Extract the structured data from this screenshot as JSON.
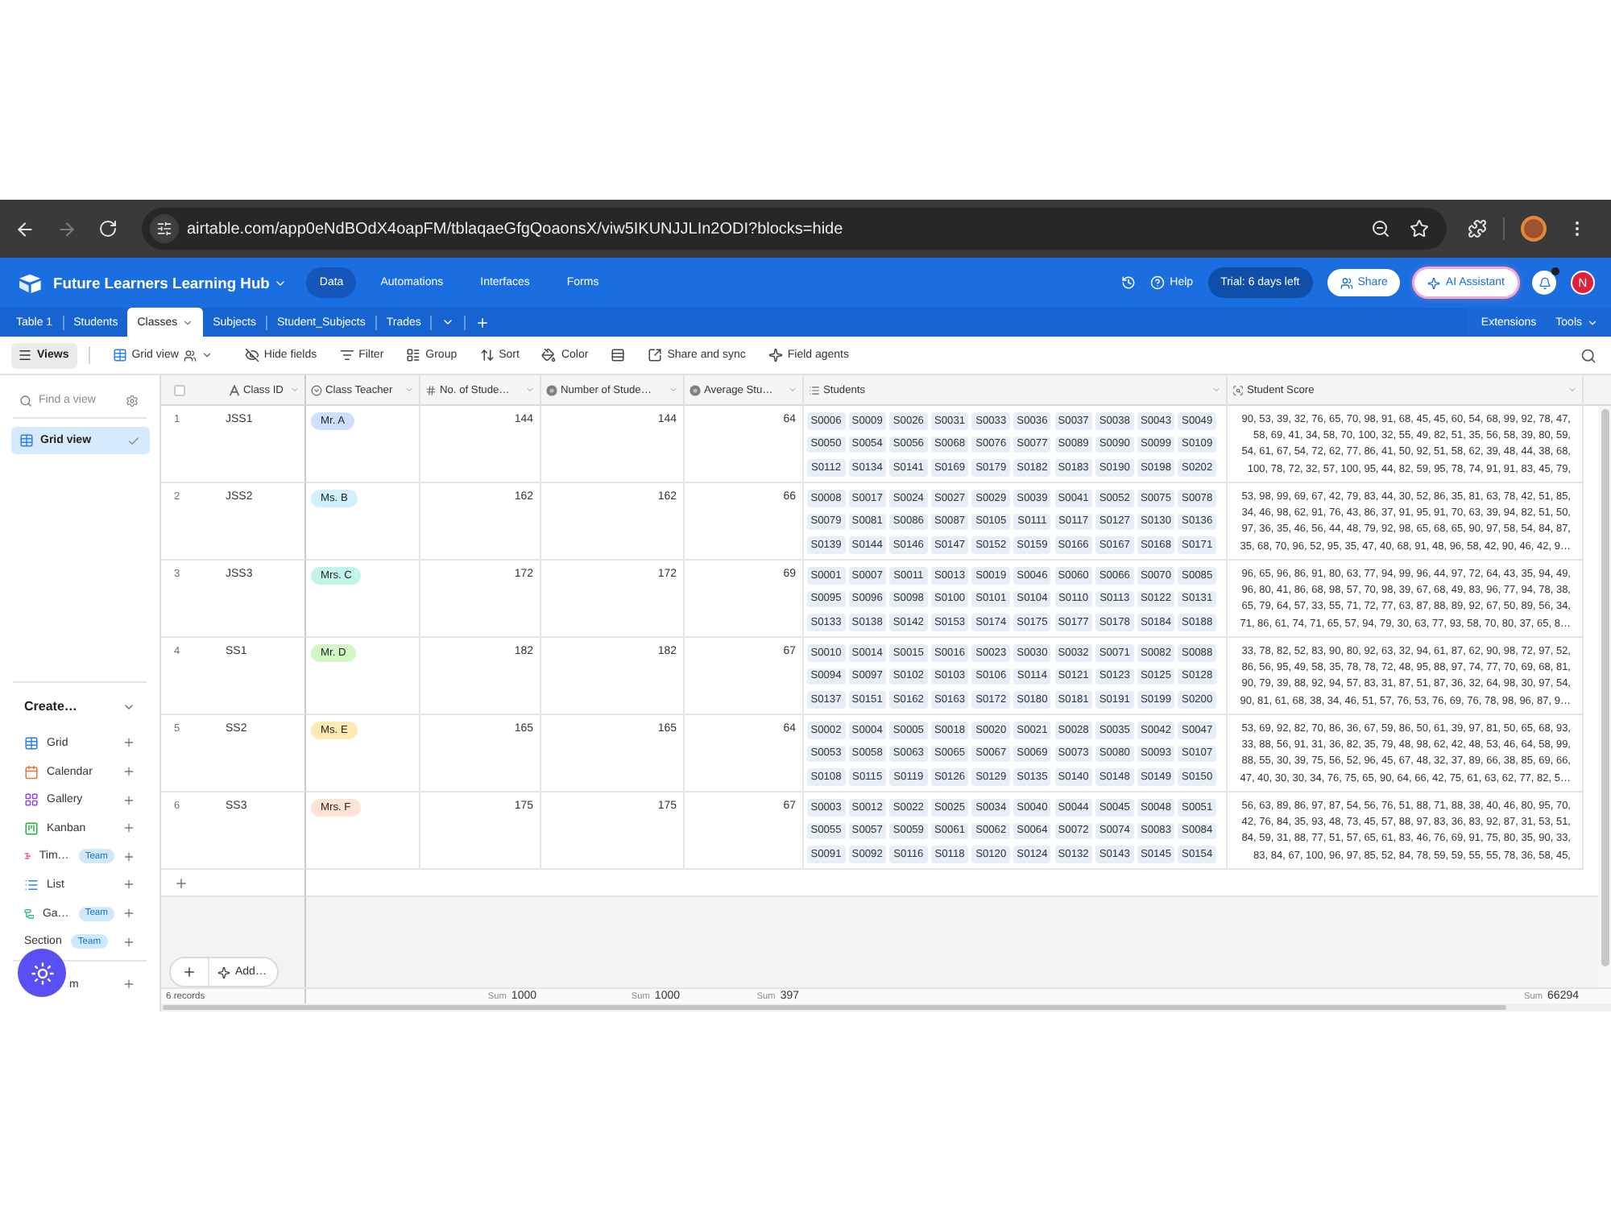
{
  "browser": {
    "url": "airtable.com/app0eNdBOdX4oapFM/tblaqaeGfgQoaonsX/viw5IKUNJJLIn2ODI?blocks=hide"
  },
  "app_bar": {
    "base_name": "Future Learners Learning Hub",
    "nav": [
      {
        "label": "Data",
        "selected": true
      },
      {
        "label": "Automations",
        "selected": false
      },
      {
        "label": "Interfaces",
        "selected": false
      },
      {
        "label": "Forms",
        "selected": false
      }
    ],
    "help": "Help",
    "trial": "Trial: 6 days left",
    "share": "Share",
    "ai_assistant": "AI Assistant",
    "avatar": "N"
  },
  "table_tabs": {
    "tabs": [
      {
        "label": "Table 1",
        "selected": false
      },
      {
        "label": "Students",
        "selected": false
      },
      {
        "label": "Classes",
        "selected": true
      },
      {
        "label": "Subjects",
        "selected": false
      },
      {
        "label": "Student_Subjects",
        "selected": false
      },
      {
        "label": "Trades",
        "selected": false
      }
    ],
    "extensions": "Extensions",
    "tools": "Tools"
  },
  "view_bar": {
    "views": "Views",
    "view_name": "Grid view",
    "actions": [
      {
        "kind": "hide",
        "label": "Hide fields"
      },
      {
        "kind": "filter",
        "label": "Filter"
      },
      {
        "kind": "group",
        "label": "Group"
      },
      {
        "kind": "sort",
        "label": "Sort"
      },
      {
        "kind": "color",
        "label": "Color"
      },
      {
        "kind": "row_height"
      },
      {
        "kind": "share",
        "label": "Share and sync"
      },
      {
        "kind": "agents",
        "label": "Field agents"
      }
    ]
  },
  "sidebar": {
    "search": {
      "placeholder": "Find a view"
    },
    "views": [
      {
        "label": "Grid view",
        "selected": true
      }
    ],
    "create": {
      "title": "Create…",
      "items": [
        {
          "kind": "grid",
          "label": "Grid"
        },
        {
          "kind": "calendar",
          "label": "Calendar"
        },
        {
          "kind": "gallery",
          "label": "Gallery"
        },
        {
          "kind": "kanban",
          "label": "Kanban"
        },
        {
          "kind": "timeline",
          "label": "Tim…",
          "badge": "Team"
        },
        {
          "kind": "list",
          "label": "List"
        },
        {
          "kind": "gantt",
          "label": "Ga…",
          "badge": "Team"
        },
        {
          "kind": "section",
          "label": "Section",
          "badge": "Team"
        }
      ],
      "more": [
        {
          "label": "m"
        }
      ]
    }
  },
  "grid": {
    "select_all": {
      "checked": false
    },
    "columns": [
      {
        "label": "Class ID",
        "kind": "text"
      },
      {
        "label": "Class Teacher",
        "kind": "select"
      },
      {
        "label": "No. of Stude…",
        "kind": "number",
        "summary": {
          "label": "Sum",
          "value": "1000"
        }
      },
      {
        "label": "Number of Stude…",
        "kind": "rollup",
        "summary": {
          "label": "Sum",
          "value": "1000"
        }
      },
      {
        "label": "Average Stu…",
        "kind": "rollup",
        "summary": {
          "label": "Sum",
          "value": "397"
        }
      },
      {
        "label": "Students",
        "kind": "link"
      },
      {
        "label": "Student Score",
        "kind": "lookup",
        "summary": {
          "label": "Sum",
          "value": "66294"
        }
      }
    ],
    "rows": [
      {
        "number": "1",
        "class_id": "JSS1",
        "teacher": {
          "label": "Mr. A",
          "color": "#cfdfff"
        },
        "no_of_students": "144",
        "number_of_students": "144",
        "average": "64",
        "students": [
          "S0006",
          "S0009",
          "S0026",
          "S0031",
          "S0033",
          "S0036",
          "S0037",
          "S0038",
          "S0043",
          "S0049",
          "S0050",
          "S0054",
          "S0056",
          "S0068",
          "S0076",
          "S0077",
          "S0089",
          "S0090",
          "S0099",
          "S0109",
          "S0112",
          "S0134",
          "S0141",
          "S0169",
          "S0179",
          "S0182",
          "S0183",
          "S0190",
          "S0198",
          "S0202"
        ],
        "student_score": [
          "90, 53, 39, 32, 76, 65, 70, 98, 91, 68, 45, 45, 60, 54, 68, 99, 92, 78, 47,",
          "58, 69, 41, 34, 58, 70, 100, 32, 55, 49, 82, 51, 35, 56, 58, 39, 80, 59,",
          "54, 61, 67, 54, 72, 62, 77, 86, 41, 50, 92, 51, 58, 62, 39, 48, 44, 38, 68,",
          "100, 78, 72, 32, 57, 100, 95, 44, 82, 59, 95, 78, 74, 91, 91, 83, 45, 79,"
        ]
      },
      {
        "number": "2",
        "class_id": "JSS2",
        "teacher": {
          "label": "Ms. B",
          "color": "#d0f0fd"
        },
        "no_of_students": "162",
        "number_of_students": "162",
        "average": "66",
        "students": [
          "S0008",
          "S0017",
          "S0024",
          "S0027",
          "S0029",
          "S0039",
          "S0041",
          "S0052",
          "S0075",
          "S0078",
          "S0079",
          "S0081",
          "S0086",
          "S0087",
          "S0105",
          "S0111",
          "S0117",
          "S0127",
          "S0130",
          "S0136",
          "S0139",
          "S0144",
          "S0146",
          "S0147",
          "S0152",
          "S0159",
          "S0166",
          "S0167",
          "S0168",
          "S0171"
        ],
        "student_score": [
          "53, 98, 99, 69, 67, 42, 79, 83, 44, 30, 52, 86, 35, 81, 63, 78, 42, 51, 85,",
          "34, 46, 98, 62, 91, 76, 43, 86, 37, 91, 95, 91, 70, 63, 39, 94, 82, 51, 50,",
          "97, 36, 35, 46, 56, 44, 48, 79, 92, 98, 65, 68, 65, 90, 97, 58, 54, 84, 87,",
          "35, 68, 70, 96, 52, 95, 35, 47, 40, 68, 91, 48, 96, 58, 42, 90, 46, 42, 9…"
        ]
      },
      {
        "number": "3",
        "class_id": "JSS3",
        "teacher": {
          "label": "Mrs. C",
          "color": "#c2f5e9"
        },
        "no_of_students": "172",
        "number_of_students": "172",
        "average": "69",
        "students": [
          "S0001",
          "S0007",
          "S0011",
          "S0013",
          "S0019",
          "S0046",
          "S0060",
          "S0066",
          "S0070",
          "S0085",
          "S0095",
          "S0096",
          "S0098",
          "S0100",
          "S0101",
          "S0104",
          "S0110",
          "S0113",
          "S0122",
          "S0131",
          "S0133",
          "S0138",
          "S0142",
          "S0153",
          "S0174",
          "S0175",
          "S0177",
          "S0178",
          "S0184",
          "S0188"
        ],
        "student_score": [
          "96, 65, 96, 86, 91, 80, 63, 77, 94, 99, 96, 44, 97, 72, 64, 43, 35, 94, 49,",
          "96, 80, 41, 86, 68, 98, 57, 70, 98, 39, 67, 68, 49, 83, 96, 77, 94, 78, 38,",
          "65, 79, 64, 57, 33, 55, 71, 72, 77, 63, 87, 88, 89, 92, 67, 50, 89, 56, 34,",
          "71, 86, 61, 74, 71, 65, 57, 94, 79, 30, 63, 77, 93, 58, 70, 80, 37, 65, 8…"
        ]
      },
      {
        "number": "4",
        "class_id": "SS1",
        "teacher": {
          "label": "Mr. D",
          "color": "#d1f7c4"
        },
        "no_of_students": "182",
        "number_of_students": "182",
        "average": "67",
        "students": [
          "S0010",
          "S0014",
          "S0015",
          "S0016",
          "S0023",
          "S0030",
          "S0032",
          "S0071",
          "S0082",
          "S0088",
          "S0094",
          "S0097",
          "S0102",
          "S0103",
          "S0106",
          "S0114",
          "S0121",
          "S0123",
          "S0125",
          "S0128",
          "S0137",
          "S0151",
          "S0162",
          "S0163",
          "S0172",
          "S0180",
          "S0181",
          "S0191",
          "S0199",
          "S0200"
        ],
        "student_score": [
          "33, 78, 82, 52, 83, 90, 80, 92, 63, 32, 94, 61, 87, 62, 90, 98, 72, 97, 52,",
          "86, 56, 95, 49, 58, 35, 78, 78, 72, 48, 95, 88, 97, 74, 77, 70, 69, 68, 81,",
          "90, 79, 39, 88, 92, 94, 57, 83, 31, 87, 51, 87, 36, 32, 64, 98, 30, 97, 54,",
          "90, 81, 61, 68, 38, 34, 46, 51, 57, 76, 53, 76, 69, 76, 78, 98, 96, 87, 9…"
        ]
      },
      {
        "number": "5",
        "class_id": "SS2",
        "teacher": {
          "label": "Ms. E",
          "color": "#ffeab6"
        },
        "no_of_students": "165",
        "number_of_students": "165",
        "average": "64",
        "students": [
          "S0002",
          "S0004",
          "S0005",
          "S0018",
          "S0020",
          "S0021",
          "S0028",
          "S0035",
          "S0042",
          "S0047",
          "S0053",
          "S0058",
          "S0063",
          "S0065",
          "S0067",
          "S0069",
          "S0073",
          "S0080",
          "S0093",
          "S0107",
          "S0108",
          "S0115",
          "S0119",
          "S0126",
          "S0129",
          "S0135",
          "S0140",
          "S0148",
          "S0149",
          "S0150"
        ],
        "student_score": [
          "53, 69, 92, 82, 70, 86, 36, 67, 59, 86, 50, 61, 39, 97, 81, 50, 65, 68, 93,",
          "33, 88, 56, 91, 31, 36, 82, 35, 79, 48, 98, 62, 42, 48, 53, 46, 64, 58, 99,",
          "88, 55, 30, 39, 75, 56, 52, 96, 45, 67, 48, 32, 37, 89, 66, 38, 85, 69, 66,",
          "47, 40, 30, 30, 34, 76, 75, 65, 90, 64, 66, 42, 75, 61, 63, 62, 77, 82, 5…"
        ]
      },
      {
        "number": "6",
        "class_id": "SS3",
        "teacher": {
          "label": "Mrs. F",
          "color": "#fee2d5"
        },
        "no_of_students": "175",
        "number_of_students": "175",
        "average": "67",
        "students": [
          "S0003",
          "S0012",
          "S0022",
          "S0025",
          "S0034",
          "S0040",
          "S0044",
          "S0045",
          "S0048",
          "S0051",
          "S0055",
          "S0057",
          "S0059",
          "S0061",
          "S0062",
          "S0064",
          "S0072",
          "S0074",
          "S0083",
          "S0084",
          "S0091",
          "S0092",
          "S0116",
          "S0118",
          "S0120",
          "S0124",
          "S0132",
          "S0143",
          "S0145",
          "S0154"
        ],
        "student_score": [
          "56, 63, 89, 86, 97, 87, 54, 56, 76, 51, 88, 71, 88, 38, 40, 46, 80, 95, 70,",
          "42, 76, 84, 35, 93, 48, 73, 45, 57, 88, 97, 83, 36, 83, 92, 87, 31, 53, 51,",
          "84, 59, 31, 88, 77, 51, 57, 65, 61, 83, 46, 76, 69, 91, 75, 80, 35, 90, 33,",
          "83, 84, 67, 100, 96, 97, 85, 52, 84, 78, 59, 59, 55, 55, 78, 36, 58, 45,"
        ]
      }
    ],
    "add_menu": "Add…",
    "records": "6 records"
  }
}
